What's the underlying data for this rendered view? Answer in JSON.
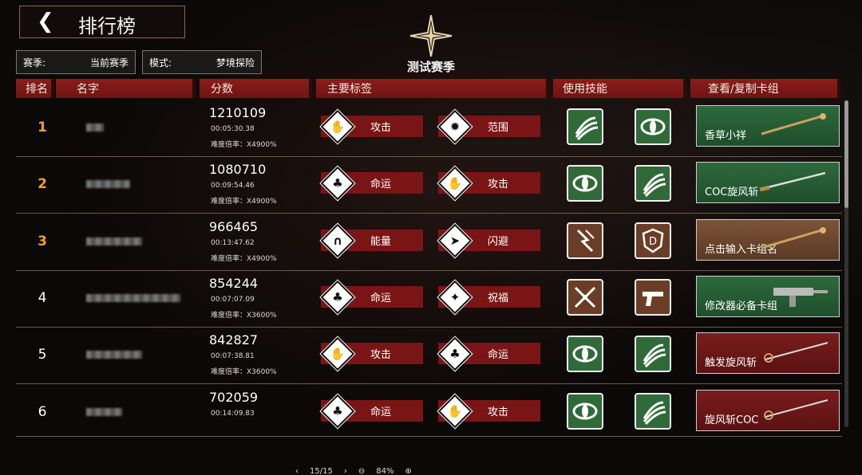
{
  "header": {
    "title": "排行榜",
    "back_icon": "chevron-left-icon"
  },
  "filters": {
    "season_label": "赛季:",
    "season_value": "当前赛季",
    "mode_label": "模式:",
    "mode_value": "梦境探险"
  },
  "season": {
    "name": "测试赛季",
    "emblem_icon": "four-point-star-icon"
  },
  "columns": {
    "rank": "排名",
    "name": "名字",
    "score": "分数",
    "tags": "主要标签",
    "skills": "使用技能",
    "deck": "查看/复制卡组"
  },
  "rows": [
    {
      "rank": "1",
      "score": "1210109",
      "time": "00:05:30.38",
      "multiplier": "难度倍率：X4900%",
      "tag1": "攻击",
      "tag1_icon": "fist-icon",
      "tag2": "范围",
      "tag2_icon": "burst-icon",
      "skill1": "claw-slash-icon",
      "skill2": "eye-icon",
      "deck": "香草小祥",
      "deck_item": "staff-icon"
    },
    {
      "rank": "2",
      "score": "1080710",
      "time": "00:09:54.46",
      "multiplier": "难度倍率：X4900%",
      "tag1": "命运",
      "tag1_icon": "clover-icon",
      "tag2": "攻击",
      "tag2_icon": "fist-icon",
      "skill1": "eye-icon",
      "skill2": "claw-slash-icon",
      "deck": "COC旋风斩",
      "deck_item": "sword-icon"
    },
    {
      "rank": "3",
      "score": "966465",
      "time": "00:13:47.62",
      "multiplier": "难度倍率：X4900%",
      "tag1": "能量",
      "tag1_icon": "horseshoe-icon",
      "tag2": "闪避",
      "tag2_icon": "dash-icon",
      "skill1": "lightning-claw-icon",
      "skill2": "shield-d-icon",
      "deck": "点击输入卡组名",
      "deck_item": "staff-icon"
    },
    {
      "rank": "4",
      "score": "854244",
      "time": "00:07:07.09",
      "multiplier": "难度倍率：X3600%",
      "tag1": "命运",
      "tag1_icon": "clover-icon",
      "tag2": "祝福",
      "tag2_icon": "sparkle-icon",
      "skill1": "crossed-swords-icon",
      "skill2": "pistol-icon",
      "deck": "修改器必备卡组",
      "deck_item": "smg-icon"
    },
    {
      "rank": "5",
      "score": "842827",
      "time": "00:07:38.81",
      "multiplier": "难度倍率：X3600%",
      "tag1": "攻击",
      "tag1_icon": "fist-icon",
      "tag2": "命运",
      "tag2_icon": "clover-icon",
      "skill1": "eye-icon",
      "skill2": "claw-slash-icon",
      "deck": "触发旋风斩",
      "deck_item": "rapier-icon"
    },
    {
      "rank": "6",
      "score": "702059",
      "time": "00:14:09.83",
      "multiplier": "",
      "tag1": "命运",
      "tag1_icon": "clover-icon",
      "tag2": "攻击",
      "tag2_icon": "fist-icon",
      "skill1": "eye-icon",
      "skill2": "claw-slash-icon",
      "deck": "旋风斩COC",
      "deck_item": "rapier-icon"
    }
  ],
  "viewer": {
    "page": "15/15",
    "zoom": "84%"
  }
}
